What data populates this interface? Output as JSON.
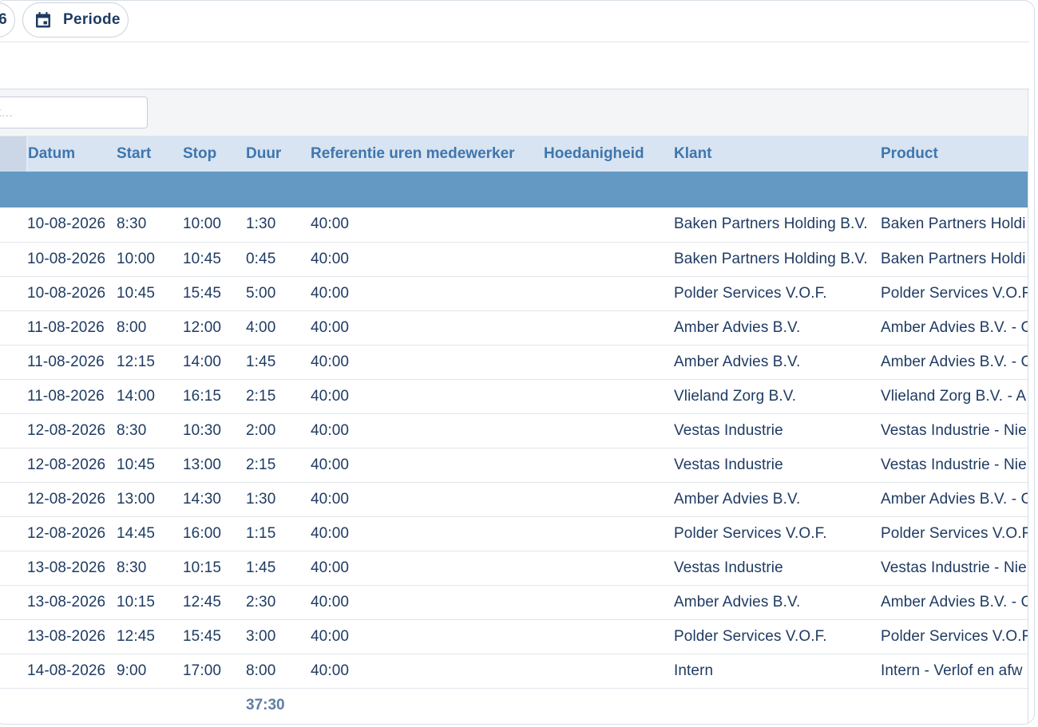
{
  "toolbar": {
    "prev_pill_text": "6",
    "periode_label": "Periode"
  },
  "search": {
    "placeholder": "Zoek..."
  },
  "table": {
    "columns": [
      "Datum",
      "Start",
      "Stop",
      "Duur",
      "Referentie uren medewerker",
      "Hoedanigheid",
      "Klant",
      "Product"
    ],
    "rows": [
      {
        "datum": "10-08-2026",
        "start": "8:30",
        "stop": "10:00",
        "duur": "1:30",
        "ref": "40:00",
        "hoedanigheid": "",
        "klant": "Baken Partners Holding B.V.",
        "product": "Baken Partners Holdi"
      },
      {
        "datum": "10-08-2026",
        "start": "10:00",
        "stop": "10:45",
        "duur": "0:45",
        "ref": "40:00",
        "hoedanigheid": "",
        "klant": "Baken Partners Holding B.V.",
        "product": "Baken Partners Holdi"
      },
      {
        "datum": "10-08-2026",
        "start": "10:45",
        "stop": "15:45",
        "duur": "5:00",
        "ref": "40:00",
        "hoedanigheid": "",
        "klant": "Polder Services V.O.F.",
        "product": "Polder Services V.O.F"
      },
      {
        "datum": "11-08-2026",
        "start": "8:00",
        "stop": "12:00",
        "duur": "4:00",
        "ref": "40:00",
        "hoedanigheid": "",
        "klant": "Amber Advies B.V.",
        "product": "Amber Advies B.V. - C"
      },
      {
        "datum": "11-08-2026",
        "start": "12:15",
        "stop": "14:00",
        "duur": "1:45",
        "ref": "40:00",
        "hoedanigheid": "",
        "klant": "Amber Advies B.V.",
        "product": "Amber Advies B.V. - C"
      },
      {
        "datum": "11-08-2026",
        "start": "14:00",
        "stop": "16:15",
        "duur": "2:15",
        "ref": "40:00",
        "hoedanigheid": "",
        "klant": "Vlieland Zorg B.V.",
        "product": "Vlieland Zorg B.V. - A"
      },
      {
        "datum": "12-08-2026",
        "start": "8:30",
        "stop": "10:30",
        "duur": "2:00",
        "ref": "40:00",
        "hoedanigheid": "",
        "klant": "Vestas Industrie",
        "product": "Vestas Industrie - Nie"
      },
      {
        "datum": "12-08-2026",
        "start": "10:45",
        "stop": "13:00",
        "duur": "2:15",
        "ref": "40:00",
        "hoedanigheid": "",
        "klant": "Vestas Industrie",
        "product": "Vestas Industrie - Nie"
      },
      {
        "datum": "12-08-2026",
        "start": "13:00",
        "stop": "14:30",
        "duur": "1:30",
        "ref": "40:00",
        "hoedanigheid": "",
        "klant": "Amber Advies B.V.",
        "product": "Amber Advies B.V. - C"
      },
      {
        "datum": "12-08-2026",
        "start": "14:45",
        "stop": "16:00",
        "duur": "1:15",
        "ref": "40:00",
        "hoedanigheid": "",
        "klant": "Polder Services V.O.F.",
        "product": "Polder Services V.O.F"
      },
      {
        "datum": "13-08-2026",
        "start": "8:30",
        "stop": "10:15",
        "duur": "1:45",
        "ref": "40:00",
        "hoedanigheid": "",
        "klant": "Vestas Industrie",
        "product": "Vestas Industrie - Nie"
      },
      {
        "datum": "13-08-2026",
        "start": "10:15",
        "stop": "12:45",
        "duur": "2:30",
        "ref": "40:00",
        "hoedanigheid": "",
        "klant": "Amber Advies B.V.",
        "product": "Amber Advies B.V. - C"
      },
      {
        "datum": "13-08-2026",
        "start": "12:45",
        "stop": "15:45",
        "duur": "3:00",
        "ref": "40:00",
        "hoedanigheid": "",
        "klant": "Polder Services V.O.F.",
        "product": "Polder Services V.O.F"
      },
      {
        "datum": "14-08-2026",
        "start": "9:00",
        "stop": "17:00",
        "duur": "8:00",
        "ref": "40:00",
        "hoedanigheid": "",
        "klant": "Intern",
        "product": "Intern - Verlof en afw"
      }
    ],
    "total_duur": "37:30"
  },
  "colors": {
    "header_bg": "#d8e4f2",
    "header_text": "#3e76ad",
    "group_row_bg": "#6399c3",
    "text": "#1f3b63",
    "total_text": "#5f7ea3"
  }
}
